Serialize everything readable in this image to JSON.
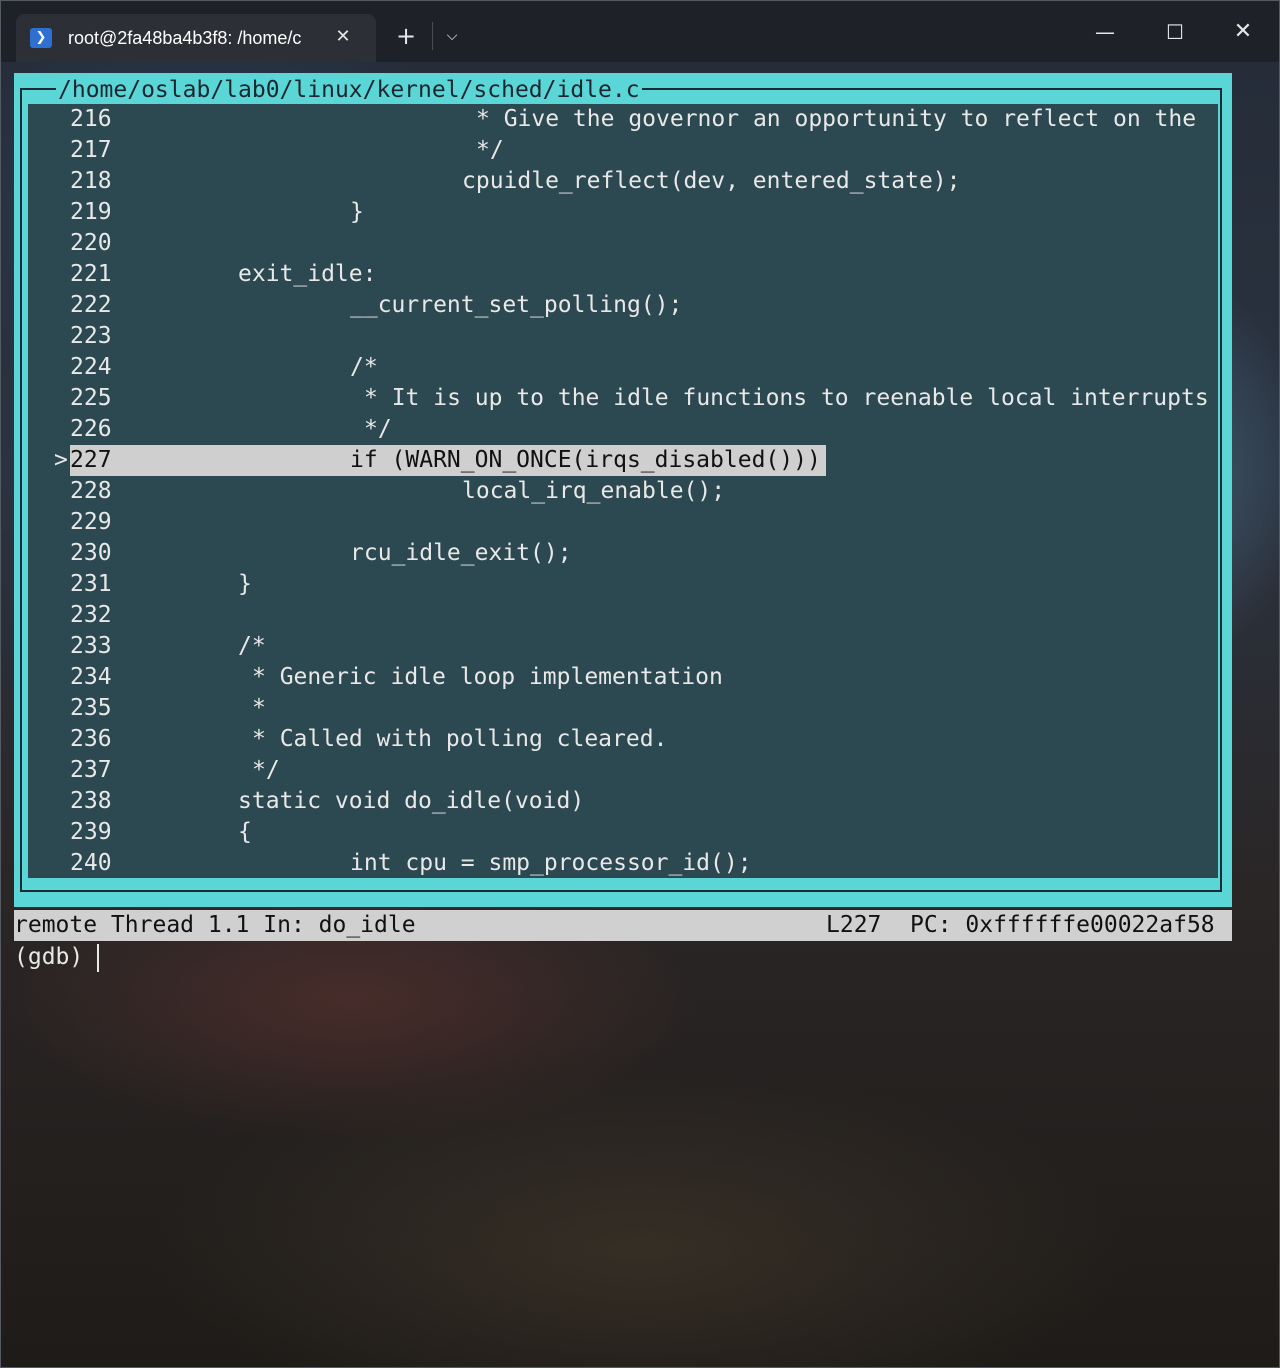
{
  "window": {
    "tab_title": "root@2fa48ba4b3f8: /home/c",
    "tab_icon": "powershell-icon",
    "new_tab_glyph": "+",
    "dropdown_glyph": "⌵",
    "close_tab_glyph": "✕",
    "minimize_glyph": "—",
    "maximize_glyph": "☐",
    "close_glyph": "✕"
  },
  "source_window": {
    "title": "/home/oslab/lab0/linux/kernel/sched/idle.c",
    "current_line": 227,
    "lines": [
      {
        "num": "216",
        "marker": "",
        "code": "                    * Give the governor an opportunity to reflect on the"
      },
      {
        "num": "217",
        "marker": "",
        "code": "                    */"
      },
      {
        "num": "218",
        "marker": "",
        "code": "                   cpuidle_reflect(dev, entered_state);"
      },
      {
        "num": "219",
        "marker": "",
        "code": "           }"
      },
      {
        "num": "220",
        "marker": "",
        "code": ""
      },
      {
        "num": "221",
        "marker": "",
        "code": "   exit_idle:"
      },
      {
        "num": "222",
        "marker": "",
        "code": "           __current_set_polling();"
      },
      {
        "num": "223",
        "marker": "",
        "code": ""
      },
      {
        "num": "224",
        "marker": "",
        "code": "           /*"
      },
      {
        "num": "225",
        "marker": "",
        "code": "            * It is up to the idle functions to reenable local interrupts"
      },
      {
        "num": "226",
        "marker": "",
        "code": "            */"
      },
      {
        "num": "227",
        "marker": ">",
        "code": "           if (WARN_ON_ONCE(irqs_disabled()))"
      },
      {
        "num": "228",
        "marker": "",
        "code": "                   local_irq_enable();"
      },
      {
        "num": "229",
        "marker": "",
        "code": ""
      },
      {
        "num": "230",
        "marker": "",
        "code": "           rcu_idle_exit();"
      },
      {
        "num": "231",
        "marker": "",
        "code": "   }"
      },
      {
        "num": "232",
        "marker": "",
        "code": ""
      },
      {
        "num": "233",
        "marker": "",
        "code": "   /*"
      },
      {
        "num": "234",
        "marker": "",
        "code": "    * Generic idle loop implementation"
      },
      {
        "num": "235",
        "marker": "",
        "code": "    *"
      },
      {
        "num": "236",
        "marker": "",
        "code": "    * Called with polling cleared."
      },
      {
        "num": "237",
        "marker": "",
        "code": "    */"
      },
      {
        "num": "238",
        "marker": "",
        "code": "   static void do_idle(void)"
      },
      {
        "num": "239",
        "marker": "",
        "code": "   {"
      },
      {
        "num": "240",
        "marker": "",
        "code": "           int cpu = smp_processor_id();"
      }
    ]
  },
  "status": {
    "left": "remote Thread 1.1 In: do_idle",
    "line": "L227",
    "pc": "PC: 0xffffffe00022af58"
  },
  "command": {
    "prompt": "(gdb) "
  },
  "colors": {
    "tui_border": "#5ad6d6",
    "highlight": "#cfcfcf",
    "status_bg": "#d0d0d0"
  }
}
